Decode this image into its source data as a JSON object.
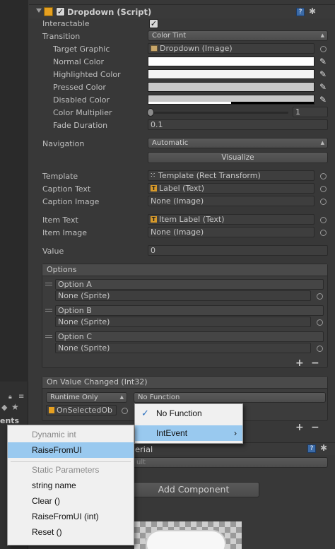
{
  "component": {
    "title": "Dropdown (Script)",
    "interactable_label": "Interactable",
    "transition_label": "Transition",
    "transition_value": "Color Tint",
    "target_graphic_label": "Target Graphic",
    "target_graphic_value": "Dropdown (Image)",
    "normal_color_label": "Normal Color",
    "highlighted_color_label": "Highlighted Color",
    "pressed_color_label": "Pressed Color",
    "disabled_color_label": "Disabled Color",
    "color_multiplier_label": "Color Multiplier",
    "color_multiplier_value": "1",
    "fade_duration_label": "Fade Duration",
    "fade_duration_value": "0.1",
    "navigation_label": "Navigation",
    "navigation_value": "Automatic",
    "visualize_label": "Visualize",
    "template_label": "Template",
    "template_value": "Template (Rect Transform)",
    "caption_text_label": "Caption Text",
    "caption_text_value": "Label (Text)",
    "caption_image_label": "Caption Image",
    "caption_image_value": "None (Image)",
    "item_text_label": "Item Text",
    "item_text_value": "Item Label (Text)",
    "item_image_label": "Item Image",
    "item_image_value": "None (Image)",
    "value_label": "Value",
    "value_value": "0",
    "colors": {
      "normal": "#ffffff",
      "highlighted": "#f5f5f5",
      "pressed": "#c8c8c8",
      "disabled": "#c8c8c8"
    }
  },
  "options": {
    "header": "Options",
    "items": [
      {
        "text": "Option A",
        "sprite": "None (Sprite)"
      },
      {
        "text": "Option B",
        "sprite": "None (Sprite)"
      },
      {
        "text": "Option C",
        "sprite": "None (Sprite)"
      }
    ],
    "plus": "+",
    "minus": "−"
  },
  "on_value_changed": {
    "header": "On Value Changed (Int32)",
    "runtime": "Runtime Only",
    "function": "No Function",
    "object": "OnSelectedOb",
    "plus": "+",
    "minus": "−"
  },
  "next_component": {
    "title_fragment": "erial",
    "sub_fragment": "ult"
  },
  "add_component_label": "Add Component",
  "left_panel": {
    "fragment": "ents"
  },
  "function_menu": {
    "items": [
      {
        "label": "No Function",
        "checked": true
      },
      {
        "label": "IntEvent",
        "submenu": true
      }
    ]
  },
  "submenu": {
    "dynamic_header": "Dynamic int",
    "dynamic_items": [
      "RaiseFromUI"
    ],
    "static_header": "Static Parameters",
    "static_items": [
      "string name",
      "Clear ()",
      "RaiseFromUI (int)",
      "Reset ()"
    ]
  }
}
